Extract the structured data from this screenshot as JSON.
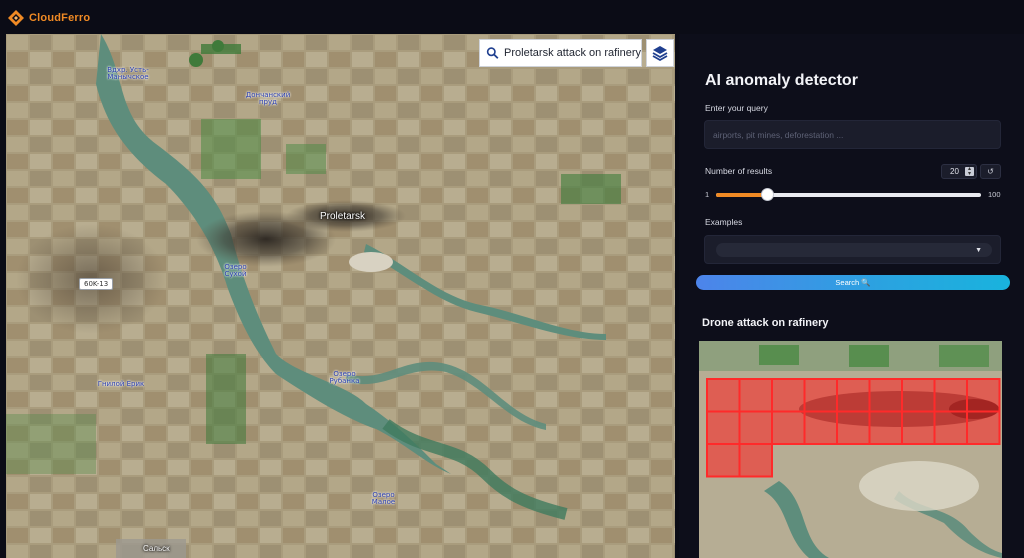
{
  "app": {
    "logo_text": "CloudFerro",
    "brand_color": "#f08a24"
  },
  "map": {
    "search_text": "Proletarsk attack on rafinery",
    "search_icon": "search-icon",
    "layers_icon": "layers-icon",
    "town_label": "Proletarsk",
    "road_shield": "60K-13",
    "labels": [
      "Вдхр. Усть-Манычское",
      "Дончанский пруд",
      "Озеро Сухой",
      "Гнилой Ерик",
      "Озеро Рубанка",
      "Озеро Малое",
      "Сальск"
    ]
  },
  "panel": {
    "title": "AI anomaly detector",
    "query_label": "Enter your query",
    "query_placeholder": "airports, pit mines, deforestation ...",
    "num_results_label": "Number of results",
    "num_results_value": "20",
    "reset_icon": "↺",
    "slider": {
      "min": "1",
      "max": "100",
      "value": 20
    },
    "examples_label": "Examples",
    "search_button": "Search 🔍",
    "result_title": "Drone attack on rafinery"
  }
}
